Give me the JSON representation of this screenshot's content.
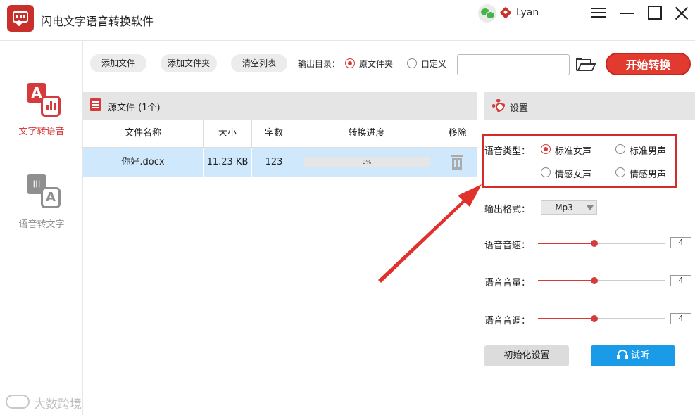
{
  "app": {
    "title": "闪电文字语音转换软件",
    "username": "Lyan"
  },
  "sidebar": {
    "items": [
      {
        "label": "文字转语音"
      },
      {
        "label": "语音转文字"
      }
    ]
  },
  "toolbar": {
    "add_file": "添加文件",
    "add_folder": "添加文件夹",
    "clear_list": "清空列表",
    "output_dir_label": "输出目录：",
    "opt_source": "原文件夹",
    "opt_custom": "自定义",
    "output_path": "",
    "start": "开始转换"
  },
  "files": {
    "title": "源文件 (1个)",
    "columns": [
      "文件名称",
      "大小",
      "字数",
      "转换进度",
      "移除"
    ],
    "rows": [
      {
        "name": "你好.docx",
        "size": "11.23 KB",
        "chars": "123",
        "progress_text": "0%",
        "progress": 0
      }
    ]
  },
  "settings": {
    "title": "设置",
    "voice_type_label": "语音类型：",
    "voices": [
      "标准女声",
      "标准男声",
      "情感女声",
      "情感男声"
    ],
    "selected_voice": "标准女声",
    "format_label": "输出格式：",
    "format_value": "Mp3",
    "speed_label": "语音音速：",
    "speed_value": "4",
    "volume_label": "语音音量：",
    "volume_value": "4",
    "pitch_label": "语音音调：",
    "pitch_value": "4",
    "reset": "初始化设置",
    "listen": "试听"
  },
  "watermark": "大数跨境",
  "colors": {
    "accent": "#e23a2e",
    "listen": "#1a9be8",
    "selected_row": "#cfe8fb",
    "highlight_box": "#d42b2b"
  }
}
